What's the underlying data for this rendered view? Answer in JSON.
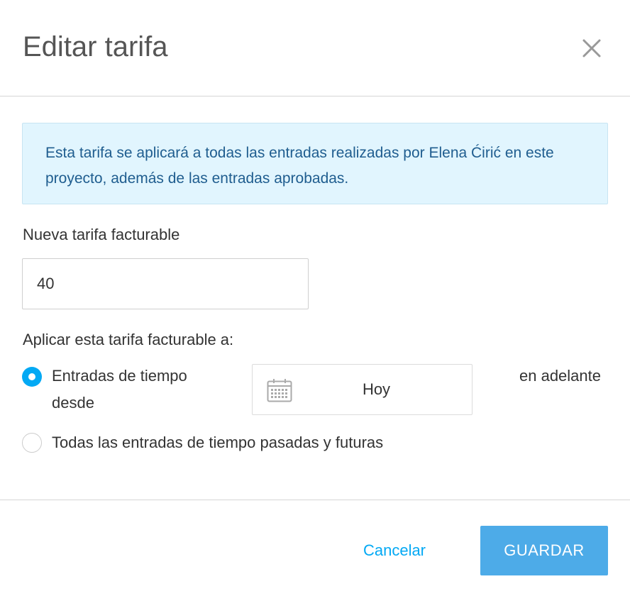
{
  "dialog": {
    "title": "Editar tarifa",
    "close_icon": "close-icon"
  },
  "info": {
    "text": "Esta tarifa se aplicará a todas las entradas realizadas por Elena Ćirić en este proyecto, además de las entradas aprobadas."
  },
  "rate": {
    "label": "Nueva tarifa facturable",
    "value": "40"
  },
  "apply": {
    "label": "Aplicar esta tarifa facturable a:",
    "options": [
      {
        "label": "Entradas de tiempo desde",
        "selected": true
      },
      {
        "label": "Todas las entradas de tiempo pasadas y futuras",
        "selected": false
      }
    ],
    "date": {
      "icon": "calendar-icon",
      "value": "Hoy"
    },
    "suffix": "en adelante"
  },
  "footer": {
    "cancel_label": "Cancelar",
    "save_label": "GUARDAR"
  },
  "colors": {
    "accent": "#03a9f4",
    "save_button": "#4dabe8",
    "info_background": "#e1f5fe",
    "info_text": "#1f5d8f"
  }
}
